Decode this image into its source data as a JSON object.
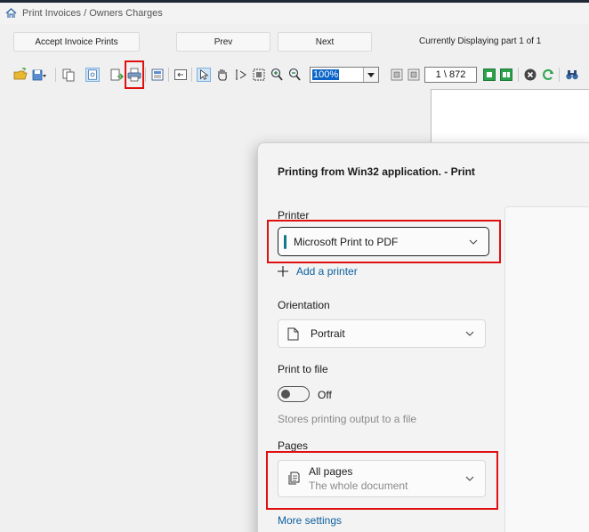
{
  "window": {
    "title": "Print Invoices / Owners Charges",
    "app_icon": "app-house-icon"
  },
  "buttons": {
    "accept": "Accept Invoice Prints",
    "prev": "Prev",
    "next": "Next"
  },
  "status": {
    "currently_displaying": "Currently Displaying part 1 of 1"
  },
  "toolbar": {
    "zoom": "100%",
    "page": "1 \\ 872",
    "icons": [
      "open-folder-icon",
      "save-dropdown-icon",
      "copy-icon",
      "page-view-icon",
      "export-icon",
      "print-icon",
      "page-setup-icon",
      "back-icon",
      "select-cursor-icon",
      "hand-pan-icon",
      "text-select-icon",
      "snapshot-icon",
      "zoom-in-icon",
      "zoom-out-icon",
      "first-page-icon",
      "prev-page-icon",
      "next-page-icon",
      "last-page-icon",
      "stop-icon",
      "refresh-icon",
      "binoculars-icon"
    ]
  },
  "dialog": {
    "title": "Printing from Win32 application. - Print",
    "printer_label": "Printer",
    "printer_value": "Microsoft Print to PDF",
    "add_printer": "Add a printer",
    "orientation_label": "Orientation",
    "orientation_value": "Portrait",
    "print_to_file_label": "Print to file",
    "print_to_file_state": "Off",
    "print_to_file_hint": "Stores printing output to a file",
    "pages_label": "Pages",
    "pages_value": "All pages",
    "pages_sub": "The whole document",
    "more_settings": "More settings"
  },
  "colors": {
    "highlight": "#e01010",
    "accent": "#0f7b8a",
    "link": "#0c5f9e"
  }
}
